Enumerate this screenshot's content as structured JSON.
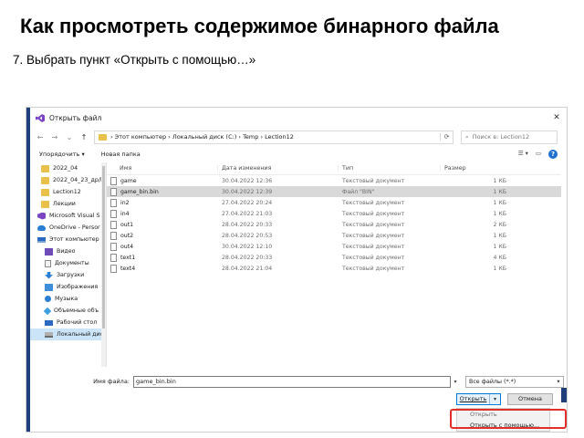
{
  "slide": {
    "title": "Как просмотреть содержимое бинарного файла",
    "step": "7. Выбрать пункт «Открыть с помощью…»"
  },
  "dialog": {
    "title": "Открыть файл",
    "close": "✕",
    "breadcrumb": "›  Этот компьютер  ›  Локальный диск (C:)  ›  Temp  ›  Lection12",
    "search_placeholder": "Поиск в: Lection12",
    "toolbar": {
      "organize": "Упорядочить ▾",
      "new_folder": "Новая папка",
      "view": "☰ ▾",
      "help": "?"
    },
    "nav": [
      {
        "label": "2022_04",
        "icon": "folder",
        "level": "sub"
      },
      {
        "label": "2022_04_23_др/l",
        "icon": "folder",
        "level": "sub"
      },
      {
        "label": "Lection12",
        "icon": "folder",
        "level": "sub"
      },
      {
        "label": "Лекции",
        "icon": "folder",
        "level": "sub"
      },
      {
        "label": "Microsoft Visual S",
        "icon": "vs",
        "level": "root"
      },
      {
        "label": "OneDrive - Persor",
        "icon": "cloud",
        "level": "root"
      },
      {
        "label": "Этот компьютер",
        "icon": "pc",
        "level": "root"
      },
      {
        "label": "Видео",
        "icon": "video",
        "level": "item"
      },
      {
        "label": "Документы",
        "icon": "doc",
        "level": "item"
      },
      {
        "label": "Загрузки",
        "icon": "down",
        "level": "item"
      },
      {
        "label": "Изображения",
        "icon": "img",
        "level": "item"
      },
      {
        "label": "Музыка",
        "icon": "music",
        "level": "item"
      },
      {
        "label": "Объемные объ",
        "icon": "cube",
        "level": "item"
      },
      {
        "label": "Рабочий стол",
        "icon": "desk",
        "level": "item"
      },
      {
        "label": "Локальный дисн",
        "icon": "disk",
        "level": "item",
        "selected": true
      }
    ],
    "columns": [
      "Имя",
      "Дата изменения",
      "Тип",
      "Размер"
    ],
    "files": [
      {
        "name": "game",
        "date": "30.04.2022 12:36",
        "type": "Текстовый документ",
        "size": "1 КБ"
      },
      {
        "name": "game_bin.bin",
        "date": "30.04.2022 12:39",
        "type": "Файл \"BIN\"",
        "size": "1 КБ",
        "selected": true
      },
      {
        "name": "in2",
        "date": "27.04.2022 20:24",
        "type": "Текстовый документ",
        "size": "1 КБ"
      },
      {
        "name": "in4",
        "date": "27.04.2022 21:03",
        "type": "Текстовый документ",
        "size": "1 КБ"
      },
      {
        "name": "out1",
        "date": "28.04.2022 20:33",
        "type": "Текстовый документ",
        "size": "2 КБ"
      },
      {
        "name": "out2",
        "date": "28.04.2022 20:53",
        "type": "Текстовый документ",
        "size": "1 КБ"
      },
      {
        "name": "out4",
        "date": "30.04.2022 12:10",
        "type": "Текстовый документ",
        "size": "1 КБ"
      },
      {
        "name": "text1",
        "date": "28.04.2022 20:33",
        "type": "Текстовый документ",
        "size": "4 КБ"
      },
      {
        "name": "text4",
        "date": "28.04.2022 21:04",
        "type": "Текстовый документ",
        "size": "1 КБ"
      }
    ],
    "filename_label": "Имя файла:",
    "filename_value": "game_bin.bin",
    "filetype_value": "Все файлы (*.*)",
    "open_button": "Открыть",
    "cancel_button": "Отмена",
    "menu": [
      "Открыть",
      "Открыть с помощью..."
    ]
  }
}
